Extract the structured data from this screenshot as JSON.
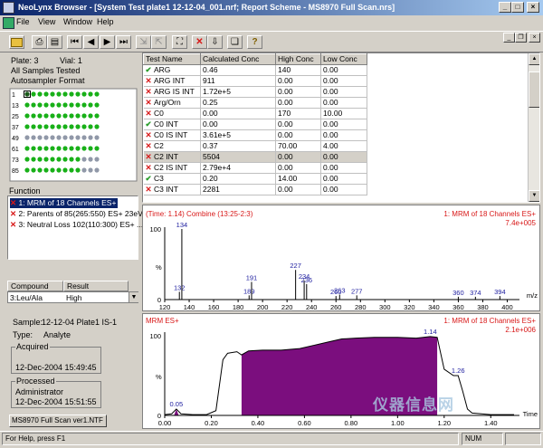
{
  "window": {
    "title": "NeoLynx Browser - [System Test plate1 12-12-04_001.nrf; Report Scheme - MS8970 Full Scan.nrs]"
  },
  "menu": [
    "File",
    "View",
    "Window",
    "Help"
  ],
  "toolbar_icons": [
    "open-folder-icon",
    "print-icon",
    "preview-icon",
    "first-icon",
    "prev-icon",
    "next-icon",
    "last-icon",
    "zoom-in-icon",
    "zoom-out-icon",
    "fit-icon",
    "delete-icon",
    "export-icon",
    "copy-icon",
    "help-icon"
  ],
  "plate": {
    "plate_label": "Plate: 3",
    "vial_label": "Vial: 1",
    "tested": "All Samples Tested",
    "format": "Autosampler Format",
    "row_labels": [
      "1",
      "13",
      "25",
      "37",
      "49",
      "61",
      "73",
      "85"
    ]
  },
  "function_panel": {
    "header": "Function",
    "items": [
      "1: MRM of 18 Channels ES+",
      "2: Parents of 85(265:550) ES+ 23eV",
      "3: Neutral Loss 102(110:300) ES+ ..."
    ]
  },
  "compound_panel": {
    "col_compound": "Compound",
    "col_result": "Result",
    "compound": "3:Leu/Ala",
    "result": "High"
  },
  "sample": {
    "sample_label": "Sample:",
    "sample_value": "12-12-04 Plate1 IS-1",
    "type_label": "Type:",
    "type_value": "Analyte",
    "acquired_label": "Acquired",
    "acquired_value": "12-Dec-2004 15:49:45",
    "processed_label": "Processed",
    "processed_by": "Administrator",
    "processed_value": "12-Dec-2004 15:51:55",
    "method_button": "MS8970 Full Scan ver1.NTF"
  },
  "results_table": {
    "headers": [
      "Test Name",
      "Calculated Conc",
      "High Conc",
      "Low Conc"
    ],
    "rows": [
      {
        "status": "pass",
        "name": "ARG",
        "calc": "0.46",
        "high": "140",
        "low": "0.00"
      },
      {
        "status": "fail",
        "name": "ARG INT",
        "calc": "911",
        "high": "0.00",
        "low": "0.00"
      },
      {
        "status": "fail",
        "name": "ARG IS INT",
        "calc": "1.72e+5",
        "high": "0.00",
        "low": "0.00"
      },
      {
        "status": "fail",
        "name": "Arg/Orn",
        "calc": "0.25",
        "high": "0.00",
        "low": "0.00"
      },
      {
        "status": "fail",
        "name": "C0",
        "calc": "0.00",
        "high": "170",
        "low": "10.00"
      },
      {
        "status": "pass",
        "name": "C0 INT",
        "calc": "0.00",
        "high": "0.00",
        "low": "0.00"
      },
      {
        "status": "fail",
        "name": "C0 IS INT",
        "calc": "3.61e+5",
        "high": "0.00",
        "low": "0.00"
      },
      {
        "status": "fail",
        "name": "C2",
        "calc": "0.37",
        "high": "70.00",
        "low": "4.00"
      },
      {
        "status": "fail",
        "name": "C2 INT",
        "calc": "5504",
        "high": "0.00",
        "low": "0.00",
        "selected": true
      },
      {
        "status": "fail",
        "name": "C2 IS INT",
        "calc": "2.79e+4",
        "high": "0.00",
        "low": "0.00"
      },
      {
        "status": "pass",
        "name": "C3",
        "calc": "0.20",
        "high": "14.00",
        "low": "0.00"
      },
      {
        "status": "fail",
        "name": "C3 INT",
        "calc": "2281",
        "high": "0.00",
        "low": "0.00"
      }
    ]
  },
  "colors": {
    "accent_red": "#d81818",
    "pass_green": "#2a9d2a",
    "chrom_fill": "#7b0e7e",
    "axis_blue": "#2020a0",
    "title_grad_start": "#0a246a",
    "title_grad_end": "#a6caf0"
  },
  "spectrum": {
    "header_left": "(Time: 1.14) Combine (13:25-2:3)",
    "header_right": "1: MRM of 18 Channels ES+",
    "intensity": "7.4e+005",
    "ylabel": "%",
    "xunit": "m/z",
    "y_ticks": [
      "100",
      "0"
    ],
    "x_ticks": [
      "120",
      "140",
      "160",
      "180",
      "200",
      "220",
      "240",
      "260",
      "280",
      "300",
      "320",
      "340",
      "360",
      "380",
      "400"
    ],
    "xlim": [
      120,
      410
    ],
    "peaks": [
      {
        "mz": 132,
        "h": 11,
        "label": "132"
      },
      {
        "mz": 134,
        "h": 100,
        "label": "134"
      },
      {
        "mz": 189,
        "h": 6,
        "label": "189"
      },
      {
        "mz": 191,
        "h": 25,
        "label": "191"
      },
      {
        "mz": 227,
        "h": 42,
        "label": "227"
      },
      {
        "mz": 234,
        "h": 27,
        "label": "234"
      },
      {
        "mz": 236,
        "h": 22,
        "label": "236"
      },
      {
        "mz": 260,
        "h": 5,
        "label": "260"
      },
      {
        "mz": 263,
        "h": 7,
        "label": "263"
      },
      {
        "mz": 277,
        "h": 6,
        "label": "277"
      },
      {
        "mz": 360,
        "h": 4,
        "label": "360"
      },
      {
        "mz": 374,
        "h": 4,
        "label": "374"
      },
      {
        "mz": 394,
        "h": 5,
        "label": "394"
      }
    ]
  },
  "chromatogram": {
    "header_left": "MRM ES+",
    "header_right": "1: MRM of 18 Channels ES+",
    "intensity": "2.1e+006",
    "ylabel": "%",
    "xunit": "Time",
    "y_ticks": [
      "100",
      "0"
    ],
    "x_ticks": [
      "0.00",
      "0.20",
      "0.40",
      "0.60",
      "0.80",
      "1.00",
      "1.20",
      "1.40"
    ],
    "xlim": [
      0,
      1.5
    ],
    "peak_labels": [
      {
        "t": 0.05,
        "y": 8,
        "label": "0.05"
      },
      {
        "t": 1.14,
        "y": 99,
        "label": "1.14"
      },
      {
        "t": 1.26,
        "y": 50,
        "label": "1.26"
      }
    ],
    "trace": [
      [
        0,
        1
      ],
      [
        0.03,
        2
      ],
      [
        0.05,
        8
      ],
      [
        0.07,
        2
      ],
      [
        0.12,
        1
      ],
      [
        0.18,
        1
      ],
      [
        0.22,
        6
      ],
      [
        0.25,
        70
      ],
      [
        0.27,
        78
      ],
      [
        0.29,
        79
      ],
      [
        0.31,
        80
      ],
      [
        0.33,
        76
      ],
      [
        0.36,
        81
      ],
      [
        0.42,
        82
      ],
      [
        0.5,
        82
      ],
      [
        0.58,
        84
      ],
      [
        0.64,
        88
      ],
      [
        0.7,
        92
      ],
      [
        0.76,
        96
      ],
      [
        0.82,
        97
      ],
      [
        0.9,
        98
      ],
      [
        1.0,
        98
      ],
      [
        1.08,
        97
      ],
      [
        1.14,
        99
      ],
      [
        1.17,
        98
      ],
      [
        1.2,
        58
      ],
      [
        1.24,
        50
      ],
      [
        1.26,
        50
      ],
      [
        1.28,
        30
      ],
      [
        1.3,
        8
      ],
      [
        1.32,
        3
      ],
      [
        1.4,
        1
      ],
      [
        1.5,
        1
      ]
    ],
    "fill_range": [
      0.33,
      1.17
    ]
  },
  "status": {
    "help": "For Help, press F1",
    "num": "NUM"
  },
  "watermark": "仪器信息网"
}
